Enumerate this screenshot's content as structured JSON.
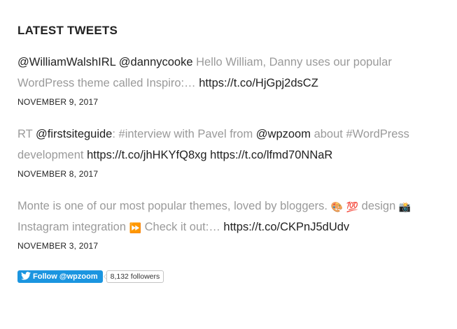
{
  "widget": {
    "title": "LATEST TWEETS"
  },
  "tweets": [
    {
      "parts": [
        {
          "type": "link",
          "text": "@WilliamWalshIRL"
        },
        {
          "type": "text",
          "text": " "
        },
        {
          "type": "link",
          "text": "@dannycooke"
        },
        {
          "type": "text",
          "text": " Hello William, Danny uses our popular WordPress theme called Inspiro:… "
        },
        {
          "type": "link",
          "text": "https://t.co/HjGpj2dsCZ"
        }
      ],
      "date": "NOVEMBER 9, 2017"
    },
    {
      "parts": [
        {
          "type": "text",
          "text": "RT "
        },
        {
          "type": "link",
          "text": "@firstsiteguide"
        },
        {
          "type": "text",
          "text": ": #interview with Pavel from "
        },
        {
          "type": "link",
          "text": "@wpzoom"
        },
        {
          "type": "text",
          "text": " about #WordPress development "
        },
        {
          "type": "link",
          "text": "https://t.co/jhHKYfQ8xg"
        },
        {
          "type": "text",
          "text": " "
        },
        {
          "type": "link",
          "text": "https://t.co/lfmd70NNaR"
        }
      ],
      "date": "NOVEMBER 8, 2017"
    },
    {
      "parts": [
        {
          "type": "text",
          "text": "Monte is one of our most popular themes, loved by bloggers. "
        },
        {
          "type": "emoji",
          "text": "🎨"
        },
        {
          "type": "text",
          "text": " "
        },
        {
          "type": "emoji",
          "text": "💯"
        },
        {
          "type": "text",
          "text": " design "
        },
        {
          "type": "emoji",
          "text": "📸"
        },
        {
          "type": "text",
          "text": " Instagram integration "
        },
        {
          "type": "emoji",
          "text": "⏩"
        },
        {
          "type": "text",
          "text": " Check it out:… "
        },
        {
          "type": "link",
          "text": "https://t.co/CKPnJ5dUdv"
        }
      ],
      "date": "NOVEMBER 3, 2017"
    }
  ],
  "follow": {
    "button_label": "Follow @wpzoom",
    "followers": "8,132 followers",
    "button_color": "#1b95e0"
  },
  "icons": {
    "follow": "twitter-bird-icon"
  }
}
